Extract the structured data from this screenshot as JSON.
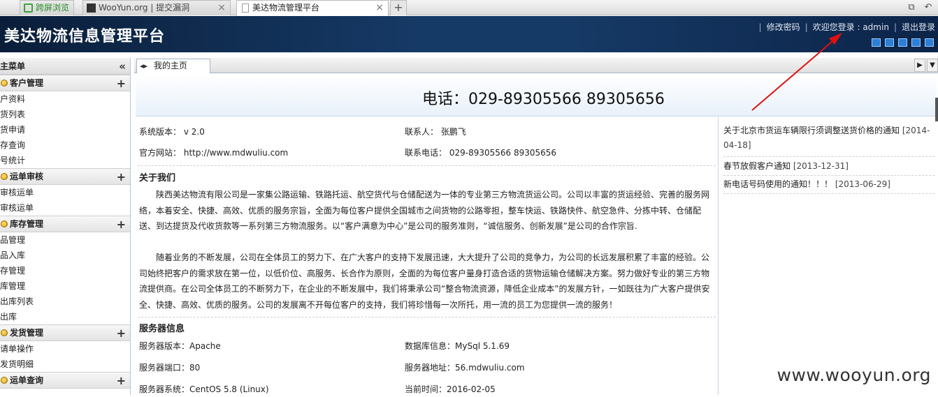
{
  "browser": {
    "tabs": [
      {
        "label": "跨屏浏览",
        "active": false
      },
      {
        "label": "WooYun.org | 提交漏洞",
        "active": false
      },
      {
        "label": "美达物流管理平台",
        "active": true
      }
    ],
    "new_tab": "+"
  },
  "header": {
    "title": "美达物流信息管理平台",
    "links": {
      "change_password": "修改密码",
      "welcome": "欢迎您登录 : admin",
      "logout": "退出登录"
    }
  },
  "sidebar": {
    "title": "主菜单",
    "collapse_icon": "«",
    "groups": [
      {
        "label": "客户管理",
        "items": [
          "户资料",
          "货列表",
          "货申请",
          "存查询",
          "号统计"
        ]
      },
      {
        "label": "运单审核",
        "items": [
          "审核运单",
          "审核运单"
        ]
      },
      {
        "label": "库存管理",
        "items": [
          "品管理",
          "品入库",
          "存管理",
          "库管理",
          "出库列表",
          "出库"
        ]
      },
      {
        "label": "发货管理",
        "items": [
          "请单操作",
          "发货明细"
        ]
      },
      {
        "label": "运单查询",
        "items": []
      }
    ]
  },
  "main": {
    "tab_label": "我的主页",
    "phone_banner": "电话：029-89305566 89305656",
    "info": {
      "system_version_label": "系统版本：",
      "system_version": "v 2.0",
      "contact_label": "联系人：",
      "contact": "张鹏飞",
      "website_label": "官方网站：",
      "website": "http://www.mdwuliu.com",
      "contact_phone_label": "联系电话：",
      "contact_phone": "029-89305566 89305656"
    },
    "about": {
      "title": "关于我们",
      "para1": "陕西美达物流有限公司是一家集公路运输、铁路托运、航空货代与仓储配送为一体的专业第三方物流货运公司。公司以丰富的货运经验、完善的服务网络，本着安全、快捷、高效、优质的服务宗旨，全面为每位客户提供全国城市之间货物的公路零担，整车快运、铁路快件、航空急件、分拣中转、仓储配送、到达提货及代收货款等一系列第三方物流服务。以“客户满意为中心”是公司的服务准则，“诚信服务、创新发展”是公司的合作宗旨.",
      "para2": "随着业务的不断发展，公司在全体员工的努力下、在广大客户的支持下发展迅速，大大提升了公司的竞争力，为公司的长远发展积累了丰富的经验。公司始终把客户的需求放在第一位，以低价位、高服务、长合作为原则，全面的为每位客户量身打造合适的货物运输仓储解决方案。努力做好专业的第三方物流提供商。在公司全体员工的不断努力下，在企业的不断发展中，我们将秉承公司“整合物流资源，降低企业成本”的发展方针，一如既往为广大客户提供安全、快捷、高效、优质的服务。公司的发展离不开每位客户的支持，我们将珍惜每一次所托，用一流的员工为您提供一流的服务！"
    },
    "server": {
      "title": "服务器信息",
      "server_version_label": "服务器版本：",
      "server_version": "Apache",
      "db_label": "数据库信息：",
      "db": "MySql 5.1.69",
      "port_label": "服务器端口：",
      "port": "80",
      "address_label": "服务器地址：",
      "address": "56.mdwuliu.com",
      "os_label": "服务器系统：",
      "os": "CentOS 5.8 (Linux)",
      "time_label": "当前时间：",
      "time": "2016-02-05"
    },
    "news": [
      {
        "title": "关于北京市货运车辆限行须调整送货价格的通知",
        "date": "[2014-04-18]"
      },
      {
        "title": "春节放假客户通知",
        "date": "[2013-12-31]"
      },
      {
        "title": "新电话号码使用的通知！！！",
        "date": "[2013-06-29]"
      }
    ]
  },
  "watermark": "www.wooyun.org",
  "colors": {
    "header_bg": "#163a66",
    "annotation_arrow": "#e01010",
    "accent_square": "#2b7fd6"
  }
}
